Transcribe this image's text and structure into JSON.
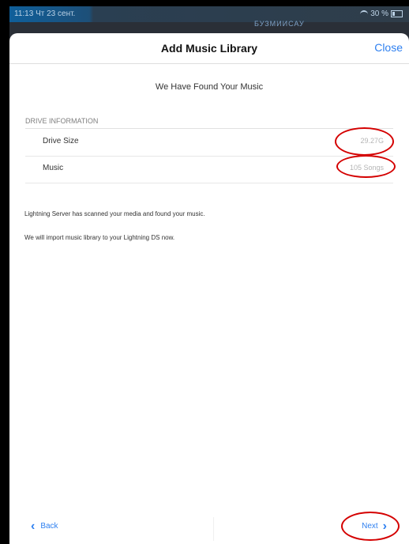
{
  "status": {
    "time": "11:13",
    "date": "Чт 23 сент.",
    "battery": "30 %",
    "background_text": "БУЗМИИСАУ"
  },
  "nav": {
    "title": "Add Music Library",
    "close": "Close"
  },
  "main": {
    "heading": "We Have Found Your Music",
    "section": "DRIVE INFORMATION",
    "rows": [
      {
        "label": "Drive Size",
        "value": "29.27G"
      },
      {
        "label": "Music",
        "value": "105 Songs"
      }
    ],
    "message1": "Lightning Server has scanned your media and found your music.",
    "message2": "We will import music library to your Lightning DS now."
  },
  "footer": {
    "back": "Back",
    "next": "Next"
  },
  "icons": {
    "back": "chevron-left-icon",
    "next": "chevron-right-icon"
  },
  "colors": {
    "accent": "#2f80f0",
    "highlight": "#d40000"
  }
}
